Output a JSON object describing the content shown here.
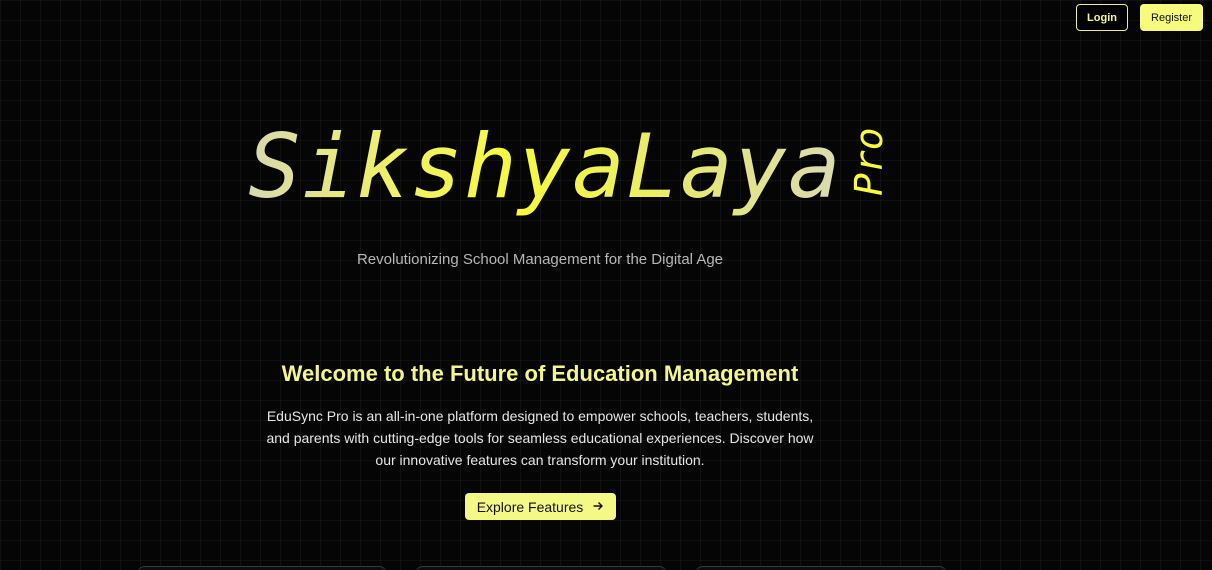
{
  "nav": {
    "login_label": "Login",
    "register_label": "Register"
  },
  "hero": {
    "brand_name": "SikshyaLaya",
    "brand_badge": "Pro",
    "tagline": "Revolutionizing School Management for the Digital Age"
  },
  "intro": {
    "heading": "Welcome to the Future of Education Management",
    "description": "EduSync Pro is an all-in-one platform designed to empower schools, teachers, students, and parents with cutting-edge tools for seamless educational experiences. Discover how our innovative features can transform your institution.",
    "cta_label": "Explore Features",
    "cta_icon": "arrow-right-icon"
  },
  "colors": {
    "accent": "#f6fb7c",
    "background": "#050505",
    "heading": "#f3f78a"
  }
}
